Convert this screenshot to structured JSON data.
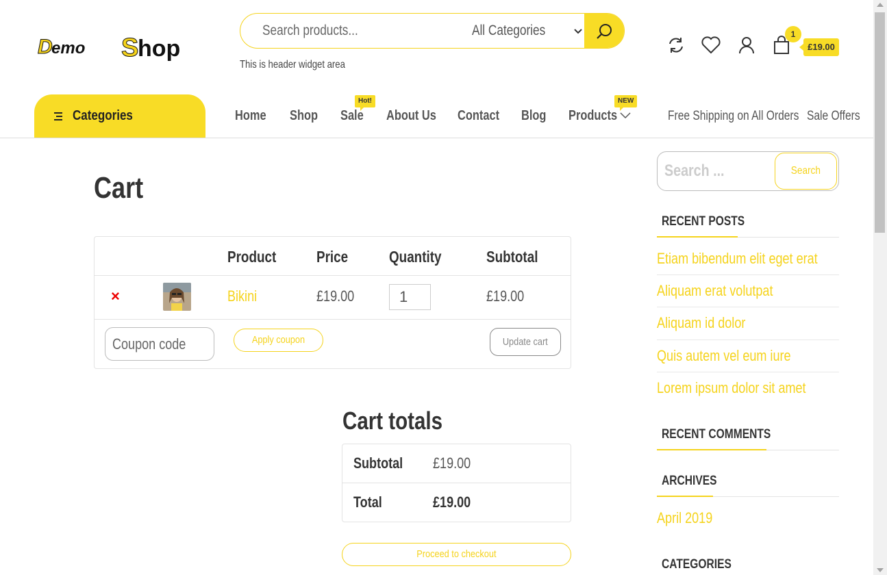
{
  "header": {
    "logo_text": "Demo Shop",
    "search_placeholder": "Search products...",
    "category_select": "All Categories",
    "widget_area_text": "This is header widget area",
    "cart_count": "1",
    "cart_total": "£19.00"
  },
  "nav": {
    "categories_label": "Categories",
    "items": [
      {
        "label": "Home"
      },
      {
        "label": "Shop"
      },
      {
        "label": "Sale",
        "badge": "Hot!"
      },
      {
        "label": "About Us"
      },
      {
        "label": "Contact"
      },
      {
        "label": "Blog"
      },
      {
        "label": "Products",
        "badge": "NEW"
      }
    ],
    "right_links": [
      "Free Shipping on All Orders",
      "Sale Offers"
    ]
  },
  "main": {
    "title": "Cart",
    "table": {
      "headers": [
        "Product",
        "Price",
        "Quantity",
        "Subtotal"
      ],
      "rows": [
        {
          "remove": "×",
          "product": "Bikini",
          "price": "£19.00",
          "quantity": "1",
          "subtotal": "£19.00"
        }
      ],
      "coupon_placeholder": "Coupon code",
      "apply_coupon": "Apply coupon",
      "update_cart": "Update cart"
    },
    "totals": {
      "title": "Cart totals",
      "subtotal_label": "Subtotal",
      "subtotal_value": "£19.00",
      "total_label": "Total",
      "total_value": "£19.00",
      "checkout": "Proceed to checkout"
    }
  },
  "sidebar": {
    "search_placeholder": "Search ...",
    "search_button": "Search",
    "recent_posts_title": "RECENT POSTS",
    "recent_posts": [
      "Etiam bibendum elit eget erat",
      "Aliquam erat volutpat",
      "Aliquam id dolor",
      "Quis autem vel eum iure",
      "Lorem ipsum dolor sit amet"
    ],
    "recent_comments_title": "RECENT COMMENTS",
    "archives_title": "ARCHIVES",
    "archives": [
      "April 2019"
    ],
    "categories_title": "CATEGORIES"
  },
  "colors": {
    "accent": "#f8dc26",
    "link": "#f5d31c",
    "remove": "#ee0000"
  }
}
